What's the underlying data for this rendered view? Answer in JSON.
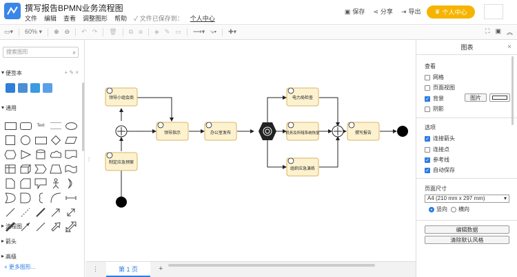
{
  "app": {
    "title": "撰写报告BPMN业务流程图",
    "menu": [
      "文件",
      "编辑",
      "查看",
      "调整图形",
      "帮助"
    ],
    "saved_status": "文件已保存到：",
    "user_center_link": "个人中心"
  },
  "top_actions": {
    "save": "保存",
    "share": "分享",
    "export": "导出",
    "template": "模板",
    "vip": "个人中心"
  },
  "toolbar": {
    "zoom": "60%"
  },
  "sidebar": {
    "search_placeholder": "搜索图形",
    "scratchpad": "便签本",
    "general": "通用",
    "flowchart": "流程图",
    "arrows": "箭头",
    "advanced": "高级",
    "more_shapes": "更多图形..."
  },
  "shapes": {
    "text_label": "Text"
  },
  "diagram": {
    "tasks": {
      "lead_decision": "领导小组会商",
      "emergency_plan": "制定应急预案",
      "lead_directive": "领导指示",
      "office_release": "办公室发布",
      "power_check": "电力局检查",
      "plant_recovery": "机务及所辖系统恢复",
      "drill": "组织应急演练",
      "write_report": "撰写报告"
    }
  },
  "page_tab": "第 1 页",
  "right_panel": {
    "title": "图表",
    "view_head": "查看",
    "view_options": [
      {
        "label": "网格",
        "checked": false
      },
      {
        "label": "页面视图",
        "checked": false
      },
      {
        "label": "背景",
        "checked": true
      },
      {
        "label": "阴影",
        "checked": false
      }
    ],
    "image_btn": "图片",
    "options_head": "选项",
    "options": [
      {
        "label": "连接箭头",
        "checked": true
      },
      {
        "label": "连接点",
        "checked": false
      },
      {
        "label": "参考线",
        "checked": true
      },
      {
        "label": "自动保存",
        "checked": true
      }
    ],
    "page_size_head": "页面尺寸",
    "page_size_value": "A4 (210 mm x 297 mm)",
    "portrait": "竖向",
    "landscape": "横向",
    "edit_data": "编辑数据",
    "clear_style": "清除默认风格"
  }
}
